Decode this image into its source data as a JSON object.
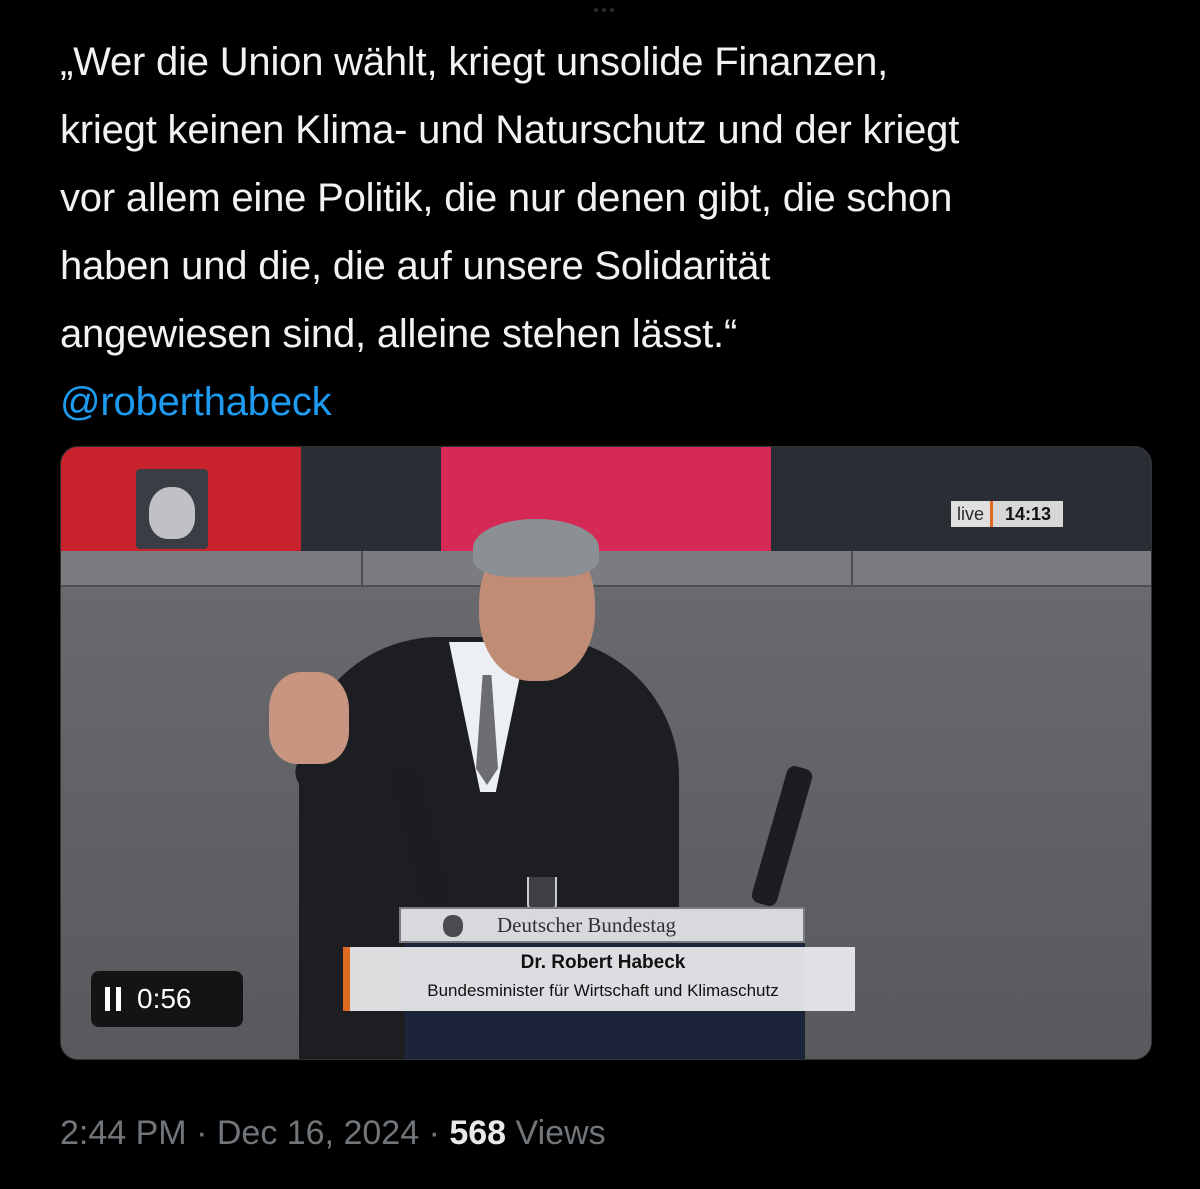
{
  "tweet": {
    "text_lines": [
      "„Wer die Union wählt, kriegt unsolide Finanzen,",
      "kriegt keinen Klima- und Naturschutz und der kriegt",
      "vor allem eine Politik, die nur denen gibt, die schon",
      "haben und die, die auf unsere Solidarität",
      "angewiesen sind, alleine stehen lässt.“"
    ],
    "mention": "@roberthabeck"
  },
  "video": {
    "live_label": "live",
    "live_time": "14:13",
    "lectern_label": "Deutscher Bundestag",
    "speaker_name": "Dr. Robert Habeck",
    "speaker_role": "Bundesminister für Wirtschaft und Klimaschutz",
    "playback_time": "0:56",
    "paused": false
  },
  "meta": {
    "time": "2:44 PM",
    "separator": "·",
    "date": "Dec 16, 2024",
    "views_count": "568",
    "views_label": "Views"
  },
  "colors": {
    "background": "#000000",
    "text": "#e7e9ea",
    "link": "#1d9bf0",
    "muted": "#71767b",
    "broadcast_accent": "#e06a1f"
  }
}
